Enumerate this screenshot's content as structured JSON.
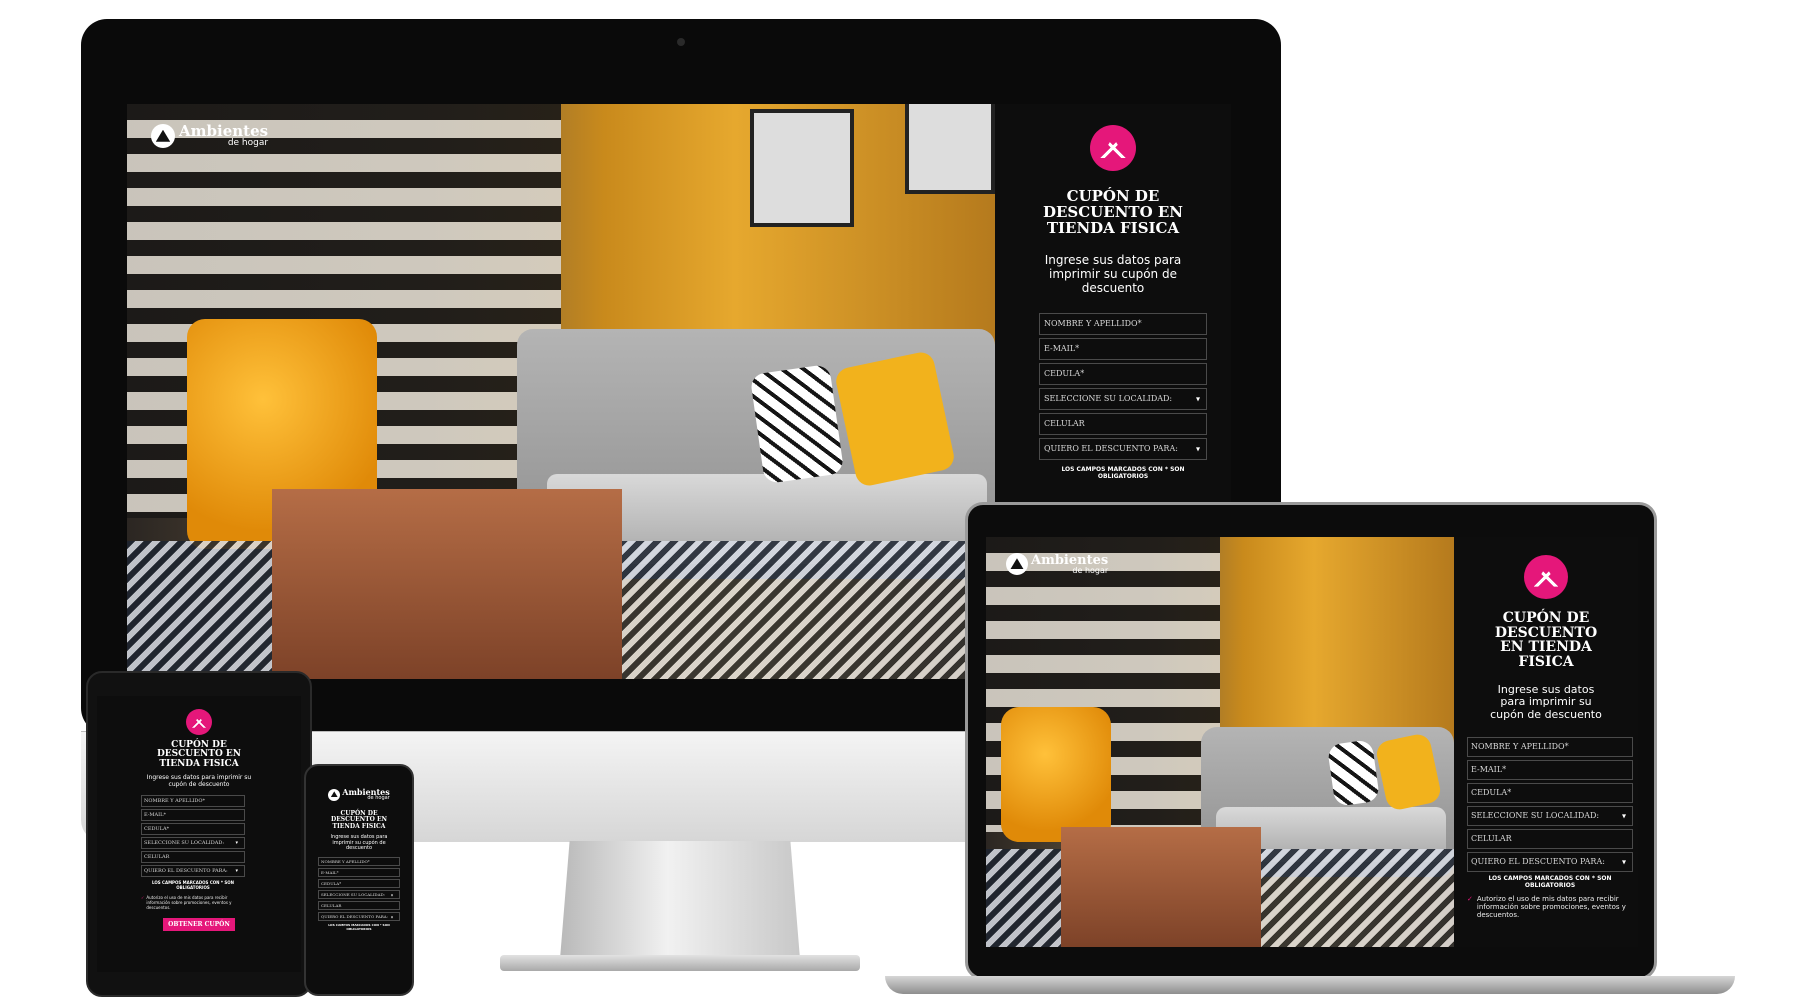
{
  "brand": {
    "name": "Ambientes",
    "tagline": "de hogar"
  },
  "form": {
    "title": "CUPÓN DE DESCUENTO EN TIENDA FISICA",
    "subtitle": "Ingrese sus datos para imprimir su cupón de descuento",
    "fields": {
      "name": "NOMBRE Y APELLIDO*",
      "email": "E-MAIL*",
      "cedula": "CEDULA*",
      "locality": "SELECCIONE SU LOCALIDAD:",
      "phone": "CELULAR",
      "discount_for": "QUIERO EL DESCUENTO PARA:"
    },
    "required_note": "LOS CAMPOS MARCADOS CON * SON OBLIGATORIOS",
    "consent": "Autorizo el uso de mis datos para recibir información sobre promociones, eventos y descuentos.",
    "submit_label": "OBTENER CUPÓN"
  },
  "colors": {
    "accent": "#e5177a",
    "panel_bg": "#0d0d0d",
    "frame": "#0a0a0a"
  },
  "icons": {
    "logo": "ambientes-logo-icon",
    "select": "chevron-down-icon",
    "check": "check-icon"
  }
}
